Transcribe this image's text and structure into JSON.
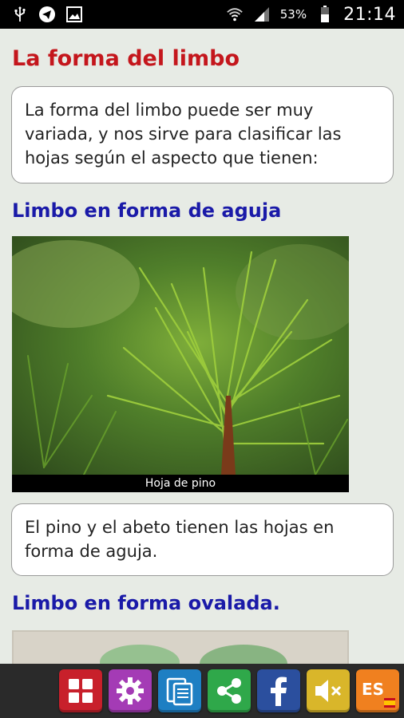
{
  "status_bar": {
    "battery_percent": "53%",
    "time": "21:14",
    "icons": [
      "usb-icon",
      "telegram-icon",
      "image-icon",
      "wifi-icon",
      "signal-icon",
      "battery-icon"
    ]
  },
  "page": {
    "title": "La forma del limbo",
    "intro": "La forma del limbo puede ser muy variada, y nos sirve para clasificar las hojas según el aspecto que tienen:",
    "sections": [
      {
        "heading": "Limbo en forma de aguja",
        "image_caption": "Hoja de pino",
        "text": "El pino y el abeto tienen las hojas en forma de aguja."
      },
      {
        "heading": "Limbo en forma ovalada."
      }
    ]
  },
  "toolbar": {
    "buttons": [
      {
        "name": "menu-grid-button",
        "icon": "grid-icon",
        "color": "#c8202b"
      },
      {
        "name": "settings-button",
        "icon": "gear-icon",
        "color": "#a43bb5"
      },
      {
        "name": "copy-button",
        "icon": "clipboard-icon",
        "color": "#1e7fc3"
      },
      {
        "name": "share-button",
        "icon": "share-icon",
        "color": "#2fa84a"
      },
      {
        "name": "facebook-button",
        "icon": "facebook-icon",
        "color": "#2b4f9e"
      },
      {
        "name": "mute-button",
        "icon": "speaker-mute-icon",
        "color": "#d9b62a"
      },
      {
        "name": "language-button",
        "icon": "flag-es-icon",
        "color": "#f0801f",
        "label": "ES"
      }
    ]
  }
}
